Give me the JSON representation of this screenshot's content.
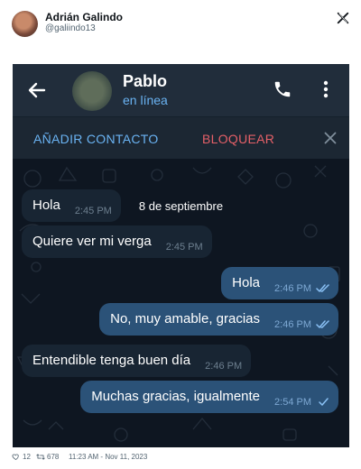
{
  "tweet": {
    "author_name": "Adrián Galindo",
    "author_handle": "@galiindo13",
    "likes": "12",
    "retweets": "678",
    "timestamp": "11:23 AM - Nov 11, 2023",
    "colors": {
      "text": "#0f1419",
      "muted": "#536471"
    }
  },
  "telegram": {
    "contact_name": "Pablo",
    "contact_status": "en línea",
    "add_contact_label": "AÑADIR CONTACTO",
    "block_label": "BLOQUEAR",
    "icons": {
      "back": "arrow-left-icon",
      "call": "phone-icon",
      "menu": "more-vertical-icon",
      "close": "close-icon"
    },
    "colors": {
      "header_bg": "#212d3b",
      "chat_bg": "#0e1621",
      "incoming_bubble": "#182533",
      "outgoing_bubble": "#2b5278",
      "accent": "#6ab3f3",
      "danger": "#e66068"
    },
    "date_separator": "8 de septiembre",
    "messages": [
      {
        "direction": "in",
        "text": "Hola",
        "time": "2:45 PM"
      },
      {
        "direction": "in",
        "text": "Quiere ver mi verga",
        "time": "2:45 PM"
      },
      {
        "direction": "out",
        "text": "Hola",
        "time": "2:46 PM",
        "status": "read"
      },
      {
        "direction": "out",
        "text": "No, muy amable, gracias",
        "time": "2:46 PM",
        "status": "read"
      },
      {
        "direction": "in",
        "text": "Entendible tenga buen día",
        "time": "2:46 PM"
      },
      {
        "direction": "out",
        "text": "Muchas gracias, igualmente",
        "time": "2:54 PM",
        "status": "sent"
      }
    ]
  }
}
